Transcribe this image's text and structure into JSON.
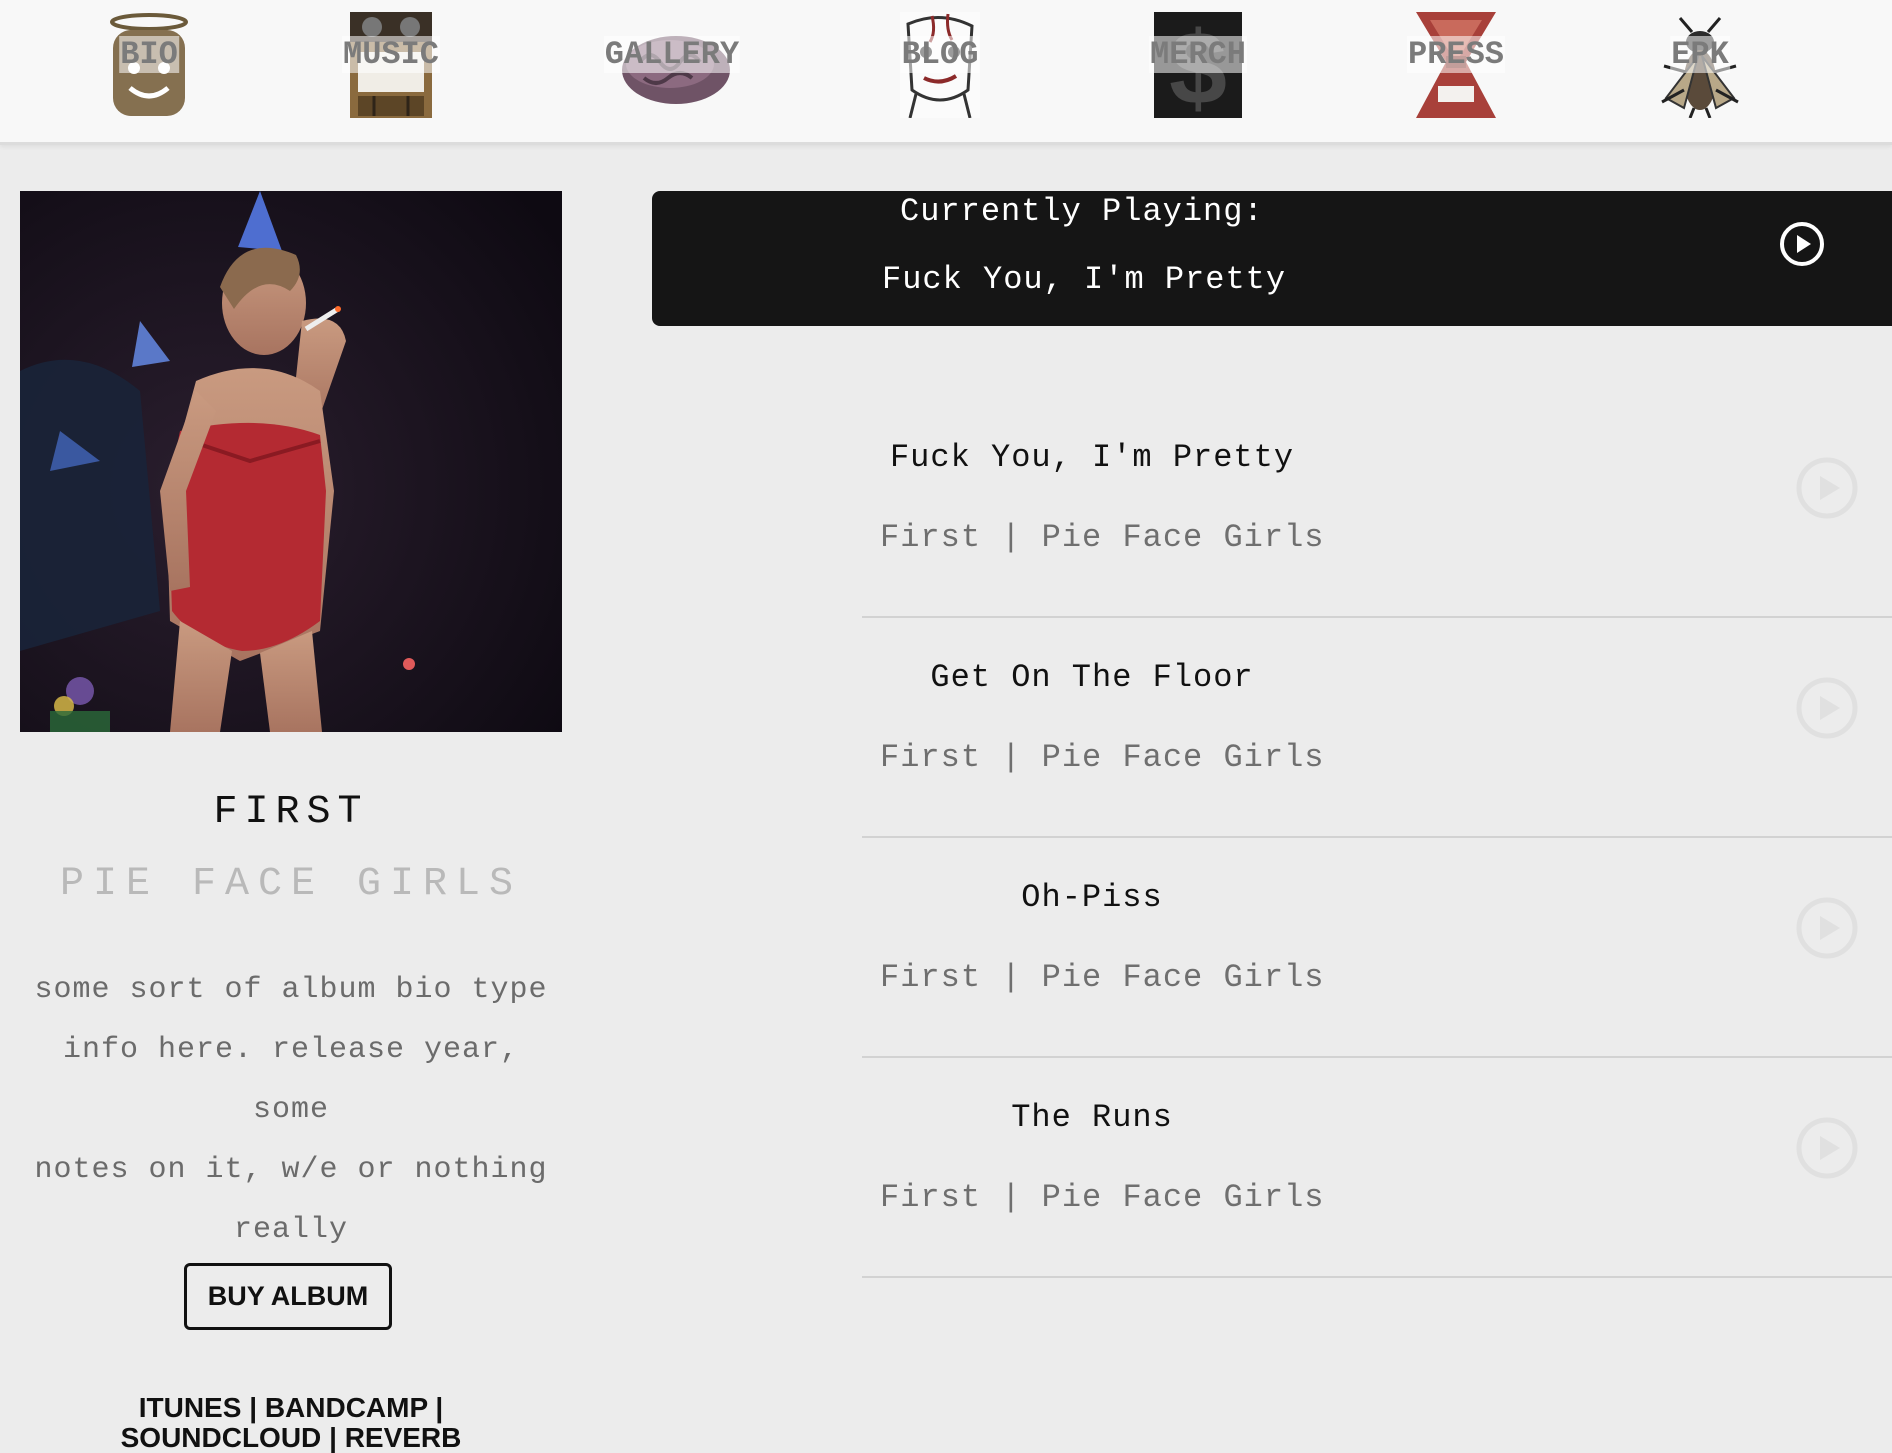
{
  "nav": {
    "items": [
      {
        "label": "BIO",
        "icon": "halo-head-icon"
      },
      {
        "label": "MUSIC",
        "icon": "cassette-radio-icon"
      },
      {
        "label": "GALLERY",
        "icon": "brain-icon"
      },
      {
        "label": "BLOG",
        "icon": "sketch-face-icon"
      },
      {
        "label": "MERCH",
        "icon": "dollar-sign-icon"
      },
      {
        "label": "PRESS",
        "icon": "hourglass-figure-icon"
      },
      {
        "label": "EPK",
        "icon": "fly-icon"
      }
    ]
  },
  "album": {
    "title": "FIRST",
    "artist": "PIE FACE GIRLS",
    "bio_lines": [
      "some sort of album bio type",
      "info here. release year, some",
      "notes on it, w/e or nothing",
      "really"
    ],
    "buy_label": "BUY ALBUM",
    "stores": [
      "ITUNES",
      "BANDCAMP",
      "SOUNDCLOUD",
      "REVERB"
    ],
    "separator": "|"
  },
  "player": {
    "heading": "Currently Playing:",
    "track": "Fuck You, I'm Pretty"
  },
  "tracks": [
    {
      "title": "Fuck You, I'm Pretty",
      "meta": "First | Pie Face Girls"
    },
    {
      "title": "Get On The Floor",
      "meta": "First | Pie Face Girls"
    },
    {
      "title": "Oh-Piss",
      "meta": "First | Pie Face Girls"
    },
    {
      "title": "The Runs",
      "meta": "First | Pie Face Girls"
    }
  ],
  "colors": {
    "background": "#ececec",
    "nav_background": "#f8f8f8",
    "player_background": "#151515",
    "artist_gray": "#b9b9b9",
    "meta_gray": "#6f6f6f"
  }
}
